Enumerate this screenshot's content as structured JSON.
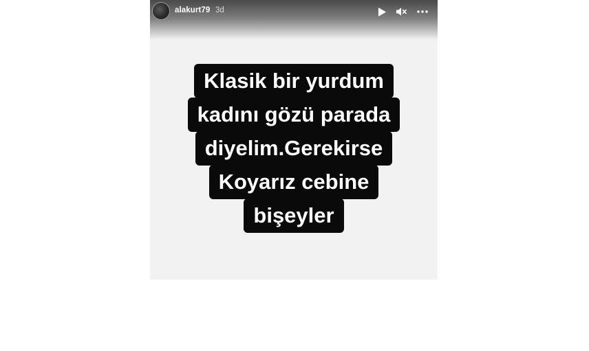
{
  "story": {
    "username": "alakurt79",
    "time_ago": "3d",
    "controls": {
      "play_icon": "play-icon",
      "mute_icon": "speaker-muted-icon",
      "more_icon": "more-horizontal-icon"
    },
    "caption_lines": [
      "Klasik bir yurdum",
      "kadını gözü parada",
      "diyelim.Gerekirse",
      "Koyarız cebine",
      "bişeyler"
    ]
  },
  "colors": {
    "caption_background": "#0a0a0a",
    "caption_text": "#ffffff",
    "story_background": "#f2f2f2"
  }
}
